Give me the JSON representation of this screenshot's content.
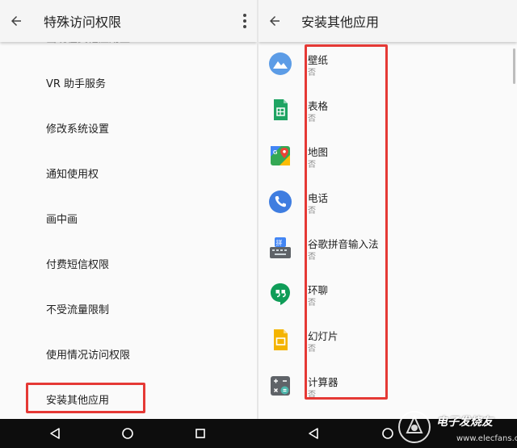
{
  "left_screen": {
    "title": "特殊访问权限",
    "partial_item": "出现在其他应用上",
    "items": [
      "VR 助手服务",
      "修改系统设置",
      "通知使用权",
      "画中画",
      "付费短信权限",
      "不受流量限制",
      "使用情况访问权限",
      "安装其他应用"
    ]
  },
  "right_screen": {
    "title": "安装其他应用",
    "apps": [
      {
        "name": "壁纸",
        "status": "否",
        "icon": "wallpaper-icon",
        "color": "#5c9ce6"
      },
      {
        "name": "表格",
        "status": "否",
        "icon": "sheets-icon",
        "color": "#1fa463"
      },
      {
        "name": "地图",
        "status": "否",
        "icon": "maps-icon",
        "color": "#34a853"
      },
      {
        "name": "电话",
        "status": "否",
        "icon": "phone-icon",
        "color": "#3f7de0"
      },
      {
        "name": "谷歌拼音输入法",
        "status": "否",
        "icon": "pinyin-ime-icon",
        "color": "#5f6368"
      },
      {
        "name": "环聊",
        "status": "否",
        "icon": "hangouts-icon",
        "color": "#0f9d58"
      },
      {
        "name": "幻灯片",
        "status": "否",
        "icon": "slides-icon",
        "color": "#f4b400"
      },
      {
        "name": "计算器",
        "status": "否",
        "icon": "calculator-icon",
        "color": "#5f6368"
      }
    ]
  },
  "watermark": {
    "text": "电子发烧友",
    "url": "www.elecfans.com"
  },
  "colors": {
    "highlight": "#e53935",
    "appbar": "#f5f5f5",
    "navbar": "#0d0d0d"
  }
}
